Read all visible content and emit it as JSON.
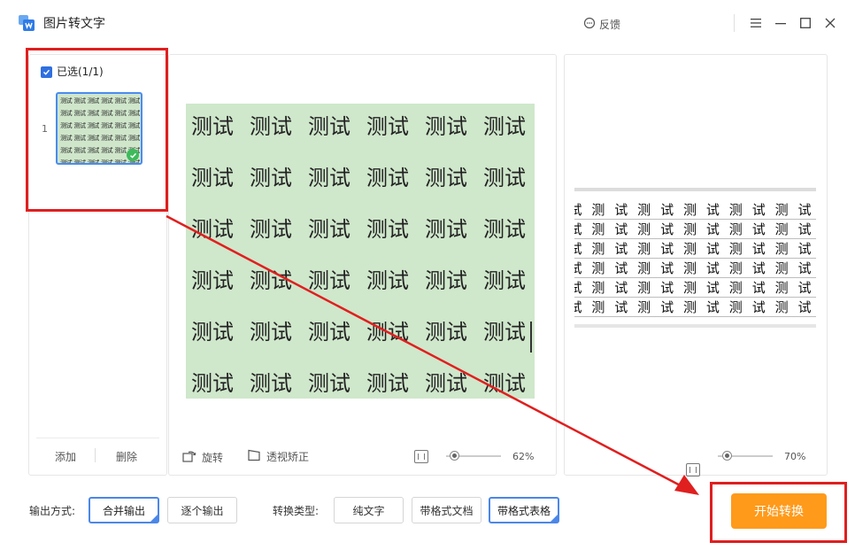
{
  "app": {
    "title": "图片转文字",
    "feedback_label": "反馈"
  },
  "left_panel": {
    "select_all_label": "已选(1/1)",
    "items": [
      {
        "index": "1",
        "selected": true,
        "thumb_text": "测试"
      }
    ],
    "add_label": "添加",
    "delete_label": "删除"
  },
  "preview": {
    "cell_text": "测试",
    "rows": 6,
    "cols": 6,
    "rotate_label": "旋转",
    "perspective_label": "透视矫正",
    "zoom": "62%"
  },
  "result": {
    "row_cells": [
      "试",
      "测",
      "试",
      "测",
      "试",
      "测",
      "试",
      "测",
      "试",
      "测",
      "试"
    ],
    "rows": 6,
    "zoom": "70%"
  },
  "options": {
    "output_label": "输出方式:",
    "output_modes": [
      {
        "label": "合并输出",
        "selected": true
      },
      {
        "label": "逐个输出",
        "selected": false
      }
    ],
    "type_label": "转换类型:",
    "types": [
      {
        "label": "纯文字",
        "selected": false
      },
      {
        "label": "带格式文档",
        "selected": false
      },
      {
        "label": "带格式表格",
        "selected": true
      }
    ]
  },
  "start_button_label": "开始转换",
  "colors": {
    "accent": "#2f6fe0",
    "start": "#ff9a1a",
    "annotation": "#e01f1f",
    "preview_bg": "#cfe7cb"
  }
}
